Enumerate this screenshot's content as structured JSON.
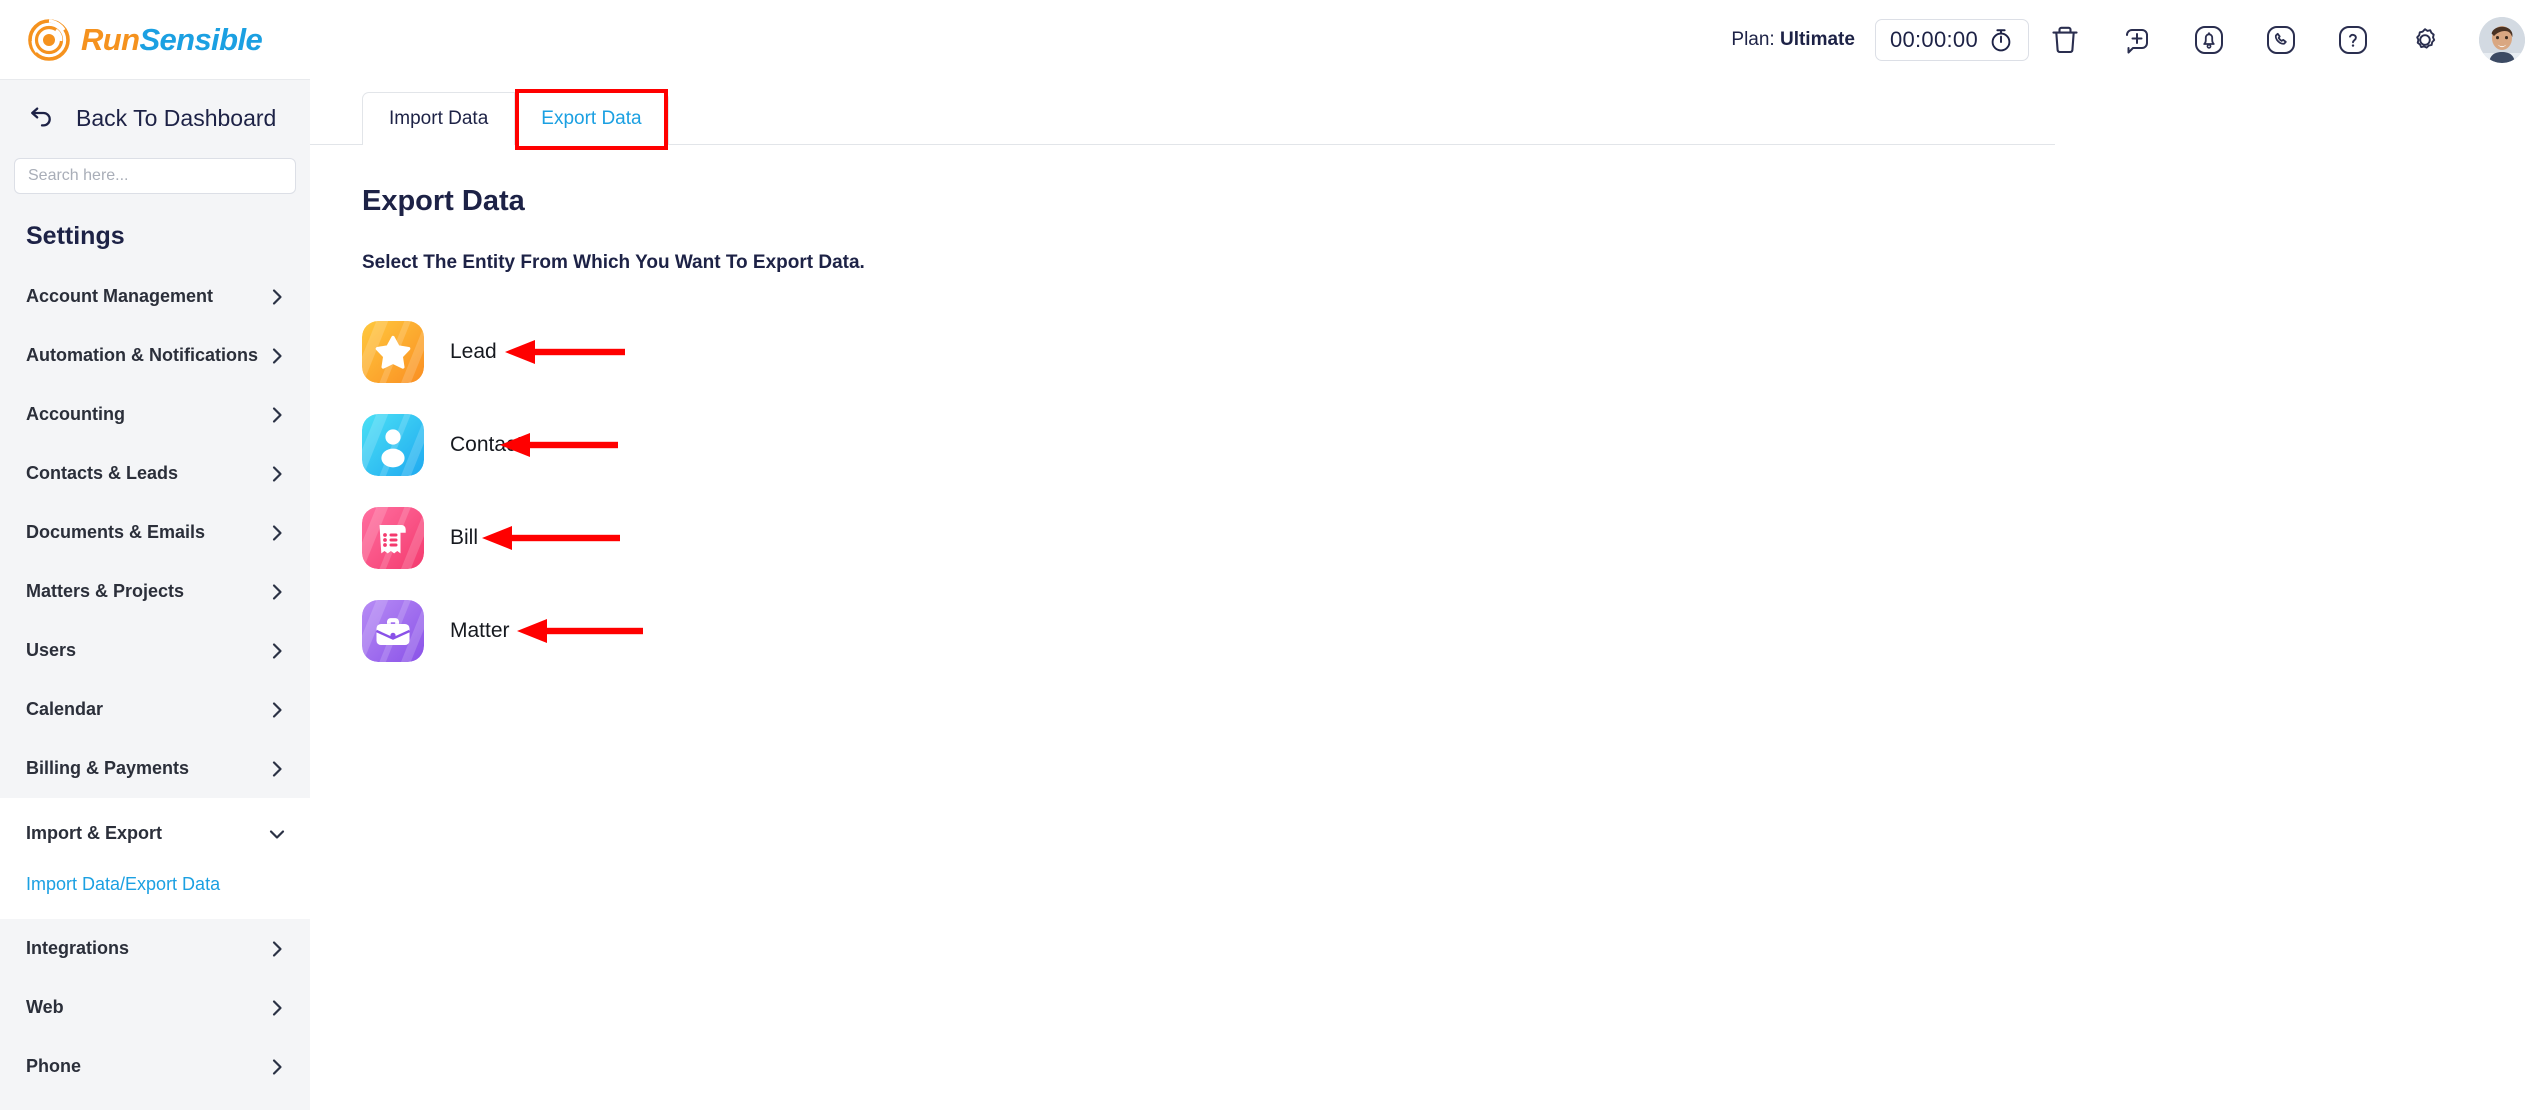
{
  "brand": {
    "name_part1": "Run",
    "name_part2": "Sensible",
    "color_orange": "#F5921E",
    "color_blue": "#1BA0E2",
    "logo_icon": "runsensible-swirl-icon"
  },
  "header": {
    "plan_prefix": "Plan:",
    "plan_value": "Ultimate",
    "timer_value": "00:00:00",
    "icons": [
      {
        "name": "stopwatch-icon"
      },
      {
        "name": "trash-icon"
      },
      {
        "name": "add-plus-icon"
      },
      {
        "name": "notification-bell-icon"
      },
      {
        "name": "phone-icon"
      },
      {
        "name": "help-question-icon"
      },
      {
        "name": "gear-icon"
      },
      {
        "name": "user-avatar"
      }
    ]
  },
  "sidebar": {
    "back_label": "Back To Dashboard",
    "back_icon": "back-arrow-icon",
    "search_placeholder": "Search here...",
    "search_value": "",
    "section_title": "Settings",
    "items": [
      {
        "label": "Account Management",
        "chevron": "chevron-right-icon",
        "expanded": false
      },
      {
        "label": "Automation & Notifications",
        "chevron": "chevron-right-icon",
        "expanded": false
      },
      {
        "label": "Accounting",
        "chevron": "chevron-right-icon",
        "expanded": false
      },
      {
        "label": "Contacts & Leads",
        "chevron": "chevron-right-icon",
        "expanded": false
      },
      {
        "label": "Documents & Emails",
        "chevron": "chevron-right-icon",
        "expanded": false
      },
      {
        "label": "Matters & Projects",
        "chevron": "chevron-right-icon",
        "expanded": false
      },
      {
        "label": "Users",
        "chevron": "chevron-right-icon",
        "expanded": false
      },
      {
        "label": "Calendar",
        "chevron": "chevron-right-icon",
        "expanded": false
      },
      {
        "label": "Billing & Payments",
        "chevron": "chevron-right-icon",
        "expanded": false
      },
      {
        "label": "Import & Export",
        "chevron": "chevron-down-icon",
        "expanded": true
      },
      {
        "label": "Integrations",
        "chevron": "chevron-right-icon",
        "expanded": false
      },
      {
        "label": "Web",
        "chevron": "chevron-right-icon",
        "expanded": false
      },
      {
        "label": "Phone",
        "chevron": "chevron-right-icon",
        "expanded": false
      }
    ],
    "active_subitem": "Import Data/Export Data",
    "active_color": "#1BA0E2"
  },
  "main": {
    "tabs": [
      {
        "label": "Import Data",
        "active": false
      },
      {
        "label": "Export Data",
        "active": true
      }
    ],
    "page_title": "Export Data",
    "page_subtitle": "Select The Entity From Which You Want To Export Data.",
    "entities": [
      {
        "label": "Lead",
        "icon": "star-icon",
        "color_from": "#FFC93E",
        "color_to": "#FA8E22"
      },
      {
        "label": "Contact",
        "icon": "person-icon",
        "color_from": "#4BE0F5",
        "color_to": "#1FA9F0"
      },
      {
        "label": "Bill",
        "icon": "invoice-icon",
        "color_from": "#FF6FA0",
        "color_to": "#F43A6E"
      },
      {
        "label": "Matter",
        "icon": "briefcase-icon",
        "color_from": "#B78CF5",
        "color_to": "#8A52E8"
      }
    ]
  },
  "annotations": {
    "highlight_color": "#FF0000",
    "tab_highlight_target": "Export Data",
    "arrows": [
      {
        "points_to": "Lead",
        "length": 120
      },
      {
        "points_to": "Contact",
        "length": 118
      },
      {
        "points_to": "Bill",
        "length": 138
      },
      {
        "points_to": "Matter",
        "length": 126
      }
    ]
  }
}
